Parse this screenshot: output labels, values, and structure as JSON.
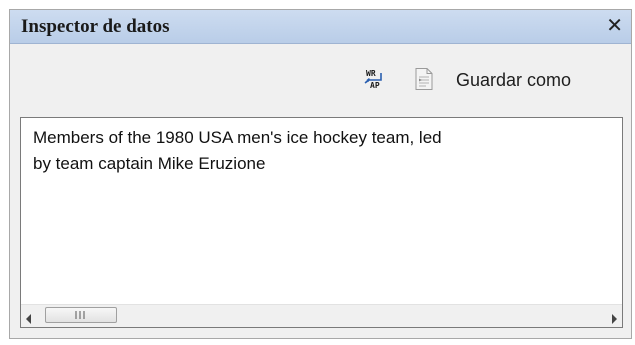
{
  "panel": {
    "title": "Inspector de datos",
    "close_glyph": "✕"
  },
  "toolbar": {
    "wrap_icon": "word-wrap-icon",
    "wrap_icon_text_top": "WR",
    "wrap_icon_text_bottom": "AP",
    "doc_icon": "document-icon",
    "save_as_label": "Guardar como"
  },
  "content": {
    "text": "Members of the 1980 USA men's ice hockey team, led\nby team captain Mike Eruzione"
  },
  "scrollbar": {
    "left_arrow_icon": "arrow-left-icon",
    "right_arrow_icon": "arrow-right-icon"
  }
}
